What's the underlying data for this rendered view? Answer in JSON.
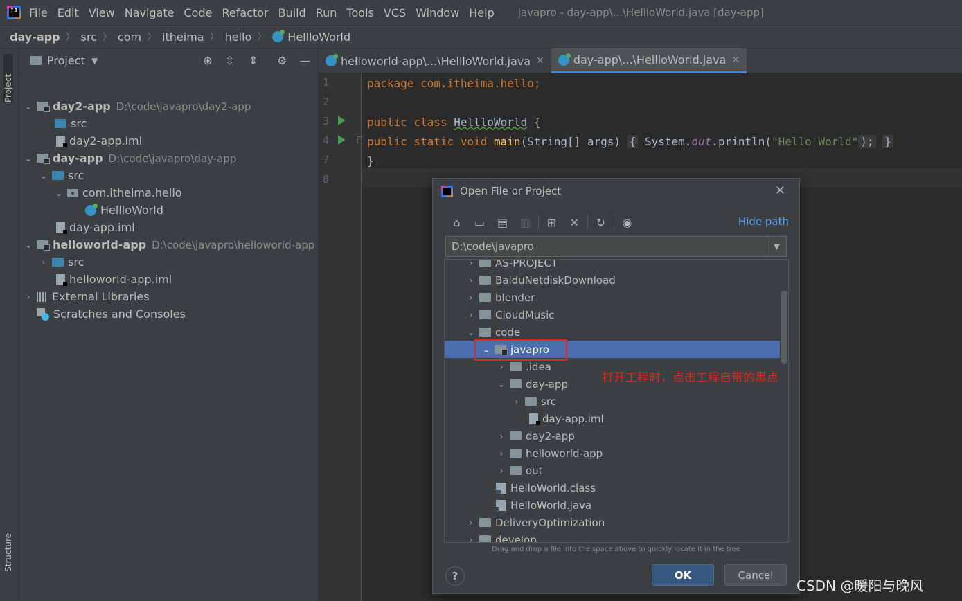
{
  "menu": {
    "logo_text": "IJ",
    "items": [
      "File",
      "Edit",
      "View",
      "Navigate",
      "Code",
      "Refactor",
      "Build",
      "Run",
      "Tools",
      "VCS",
      "Window",
      "Help"
    ],
    "window_title": "javapro - day-app\\...\\HellloWorld.java [day-app]"
  },
  "breadcrumb": [
    "day-app",
    "src",
    "com",
    "itheima",
    "hello",
    "HellloWorld"
  ],
  "left_stripe": {
    "project": "Project",
    "structure": "Structure"
  },
  "project_panel": {
    "title": "Project",
    "tree": [
      {
        "name": "day2-app",
        "path": "D:\\code\\javapro\\day2-app"
      },
      {
        "name": "src"
      },
      {
        "name": "day2-app.iml"
      },
      {
        "name": "day-app",
        "path": "D:\\code\\javapro\\day-app"
      },
      {
        "name": "src"
      },
      {
        "name": "com.itheima.hello"
      },
      {
        "name": "HellloWorld"
      },
      {
        "name": "day-app.iml"
      },
      {
        "name": "helloworld-app",
        "path": "D:\\code\\javapro\\helloworld-app"
      },
      {
        "name": "src"
      },
      {
        "name": "helloworld-app.iml"
      },
      {
        "name": "External Libraries"
      },
      {
        "name": "Scratches and Consoles"
      }
    ]
  },
  "editor": {
    "tabs": [
      "helloworld-app\\...\\HellloWorld.java",
      "day-app\\...\\HellloWorld.java"
    ],
    "line_numbers": [
      "1",
      "2",
      "3",
      "4",
      "7",
      "8"
    ],
    "code": {
      "l1_kw": "package",
      "l1_rest": " com.itheima.hello;",
      "l3_kw": "public class",
      "l3_name": "HellloWorld",
      "l3_rest": " {",
      "l4_kw": "public static void",
      "l4_fn": "main",
      "l4_args": "(String[] args)",
      "l4_open": "{",
      "l4_sys": " System.",
      "l4_out": "out",
      "l4_call": ".println(",
      "l4_str": "\"Hello World\"",
      "l4_end": ");",
      "l4_close": "}",
      "l7": "}"
    }
  },
  "dialog": {
    "title": "Open File or Project",
    "hide_path": "Hide path",
    "path_value": "D:\\code\\javapro",
    "tree": [
      "AS-PROJECT",
      "BaiduNetdiskDownload",
      "blender",
      "CloudMusic",
      "code",
      "javapro",
      ".idea",
      "day-app",
      "src",
      "day-app.iml",
      "day2-app",
      "helloworld-app",
      "out",
      "HelloWorld.class",
      "HelloWorld.java",
      "DeliveryOptimization",
      "develop"
    ],
    "drag_hint": "Drag and drop a file into the space above to quickly locate it in the tree",
    "help": "?",
    "ok": "OK",
    "cancel": "Cancel"
  },
  "annotation": "打开工程时，点击工程自带的黑点",
  "watermark": "CSDN @暖阳与晚风",
  "colors": {
    "accent": "#4a88c7",
    "selection": "#4b6eaf",
    "annotation": "#e0281e",
    "run": "#499c54"
  }
}
